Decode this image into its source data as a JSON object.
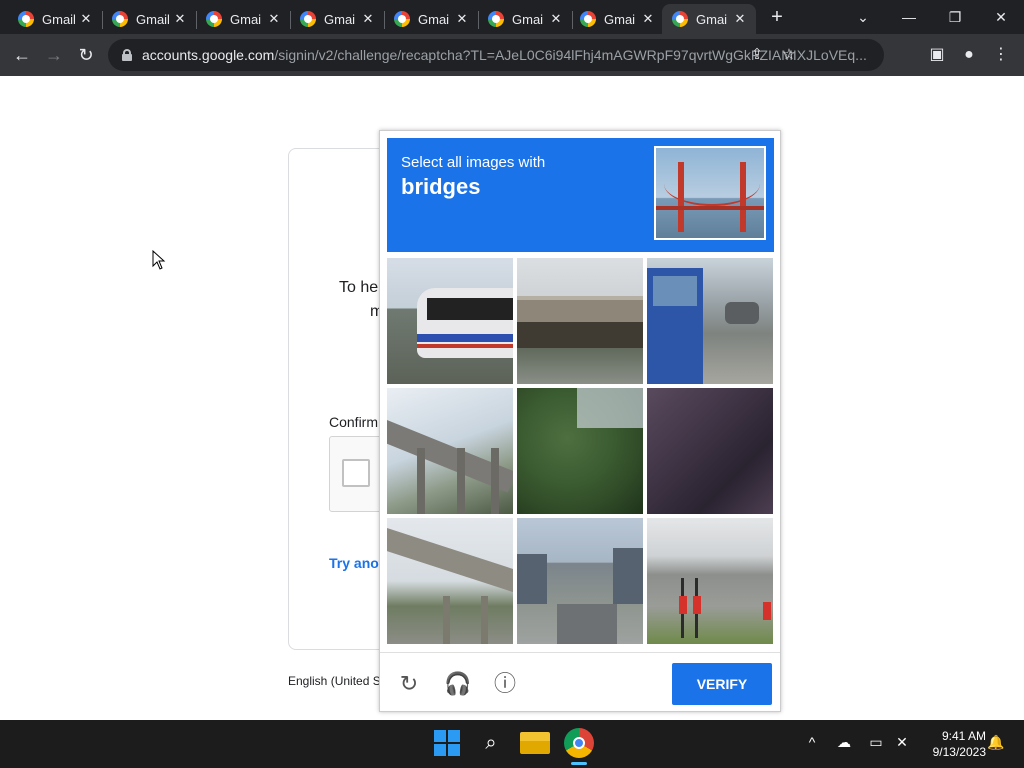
{
  "browser": {
    "tabs": [
      {
        "label": "Gmail",
        "close": "✕"
      },
      {
        "label": "Gmail",
        "close": "✕"
      },
      {
        "label": "Gmai",
        "close": "✕"
      },
      {
        "label": "Gmai",
        "close": "✕"
      },
      {
        "label": "Gmai",
        "close": "✕"
      },
      {
        "label": "Gmai",
        "close": "✕"
      },
      {
        "label": "Gmai",
        "close": "✕"
      },
      {
        "label": "Gmai",
        "close": "✕",
        "active": true
      }
    ],
    "new_tab": "+",
    "window_controls": {
      "menu": "⌄",
      "minimize": "—",
      "restore": "❐",
      "close": "✕"
    },
    "nav": {
      "back": "←",
      "forward": "→",
      "reload": "↻"
    },
    "url_host": "accounts.google.com",
    "url_path": "/signin/v2/challenge/recaptcha?TL=AJeL0C6i94lFhj4mAGWRpF97qvrtWgGkFZIAMIXJLoVEq...",
    "toolbar_icons": {
      "share": "⇪",
      "bookmark": "☆",
      "sidepanel": "▣",
      "profile": "●",
      "menu": "⋮"
    }
  },
  "page": {
    "line1": "To he",
    "line2": "m",
    "confirm_label": "Confirm",
    "try_link": "Try anot",
    "language": "English (United S"
  },
  "captcha": {
    "instruction": "Select all images with",
    "target": "bridges",
    "verify_label": "VERIFY",
    "footer_icons": {
      "reload": "↻",
      "audio": "🎧",
      "info": "ⓘ"
    },
    "tiles": [
      "bus-roadside",
      "overpass",
      "blue-bus-street",
      "highway-bridge",
      "tree",
      "dark-closeup",
      "curved-bridge",
      "city-street",
      "scooters-street"
    ]
  },
  "taskbar": {
    "tray": {
      "chevron": "^",
      "network": "☁",
      "display": "▭",
      "sound": "✕",
      "notifications": "🔔"
    },
    "time": "9:41 AM",
    "date": "9/13/2023"
  },
  "colors": {
    "captcha_blue": "#1a73e8",
    "browser_dark": "#202124",
    "toolbar": "#35363a"
  }
}
